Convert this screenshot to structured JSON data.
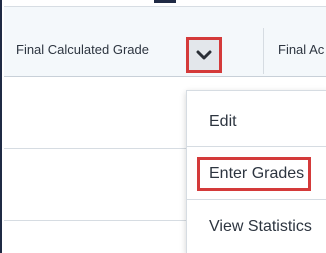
{
  "grid": {
    "columns": [
      {
        "label": "Final Calculated Grade"
      },
      {
        "label": "Final Ac"
      }
    ],
    "column_menu_button": {
      "icon": "chevron-down-icon"
    }
  },
  "dropdown": {
    "items": [
      {
        "label": "Edit"
      },
      {
        "label": "Enter Grades",
        "highlighted": true
      },
      {
        "label": "View Statistics"
      }
    ]
  },
  "colors": {
    "annotation_red": "#d43a3a",
    "header_bg": "#f4f8fb",
    "text": "#2d3540"
  }
}
